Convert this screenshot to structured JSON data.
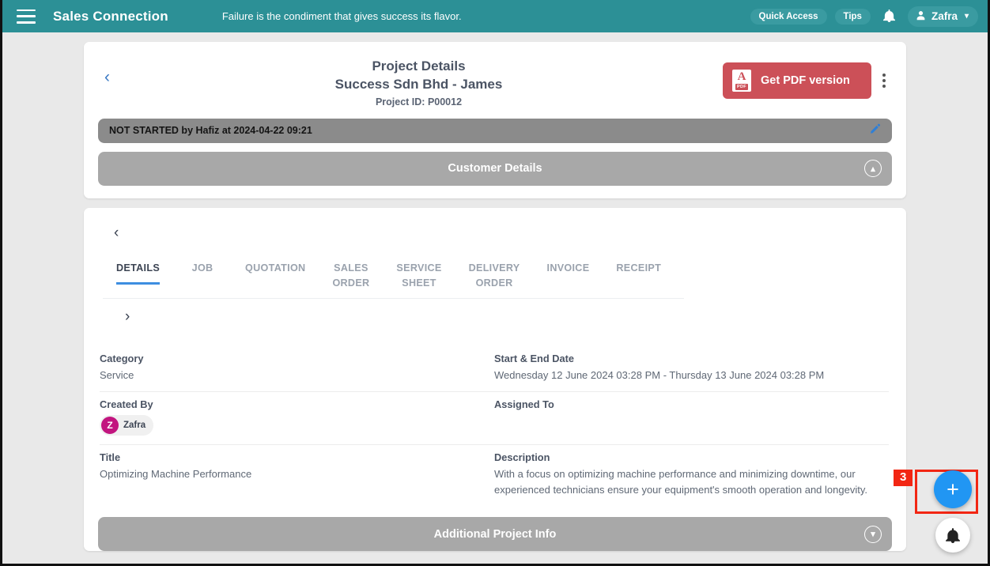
{
  "topbar": {
    "menu_icon": "hamburger-icon",
    "brand": "Sales Connection",
    "quote": "Failure is the condiment that gives success its flavor.",
    "quick_access": "Quick Access",
    "tips": "Tips",
    "bell_icon": "bell-icon",
    "user_name": "Zafra",
    "user_icon": "user-icon",
    "caret": "⌄",
    "bg_color": "#2c9096"
  },
  "header_card": {
    "back_icon": "‹",
    "title_line1": "Project Details",
    "title_line2": "Success Sdn Bhd - James",
    "project_id": "Project ID: P00012",
    "pdf_button": "Get PDF version",
    "pdf_icon_label": "PDF",
    "pdf_button_color": "#cc5058",
    "kebab_icon": "more-vertical-icon",
    "status_text": "NOT STARTED by Hafiz at 2024-04-22 09:21",
    "status_bg": "#8b8b8b",
    "edit_icon": "✎",
    "customer_details_label": "Customer Details",
    "customer_details_chevron": "⌃",
    "section_bg": "#a8a8a8"
  },
  "detail_card": {
    "back_icon": "‹",
    "next_icon": "›",
    "tabs": [
      {
        "label": "DETAILS",
        "active": true
      },
      {
        "label": "JOB",
        "active": false
      },
      {
        "label": "QUOTATION",
        "active": false
      },
      {
        "label": "SALES\nORDER",
        "active": false
      },
      {
        "label": "SERVICE\nSHEET",
        "active": false
      },
      {
        "label": "DELIVERY\nORDER",
        "active": false
      },
      {
        "label": "INVOICE",
        "active": false
      },
      {
        "label": "RECEIPT",
        "active": false
      }
    ],
    "active_tab_color": "#3d8ee0",
    "fields": {
      "category_label": "Category",
      "category_value": "Service",
      "dates_label": "Start & End Date",
      "dates_value": "Wednesday 12 June 2024 03:28 PM - Thursday 13 June 2024 03:28 PM",
      "created_by_label": "Created By",
      "created_by_initial": "Z",
      "created_by_name": "Zafra",
      "avatar_color": "#c2157f",
      "assigned_to_label": "Assigned To",
      "assigned_to_value": "",
      "title_label": "Title",
      "title_value": "Optimizing Machine Performance",
      "description_label": "Description",
      "description_value": "With a focus on optimizing machine performance and minimizing downtime, our experienced technicians ensure your equipment's smooth operation and longevity."
    },
    "additional_info_label": "Additional Project Info",
    "additional_info_chevron": "⌄"
  },
  "floating": {
    "annotation_number": "3",
    "annotation_color": "#f22613",
    "add_icon": "+",
    "add_color": "#2196f3",
    "bell_icon": "🔔"
  }
}
